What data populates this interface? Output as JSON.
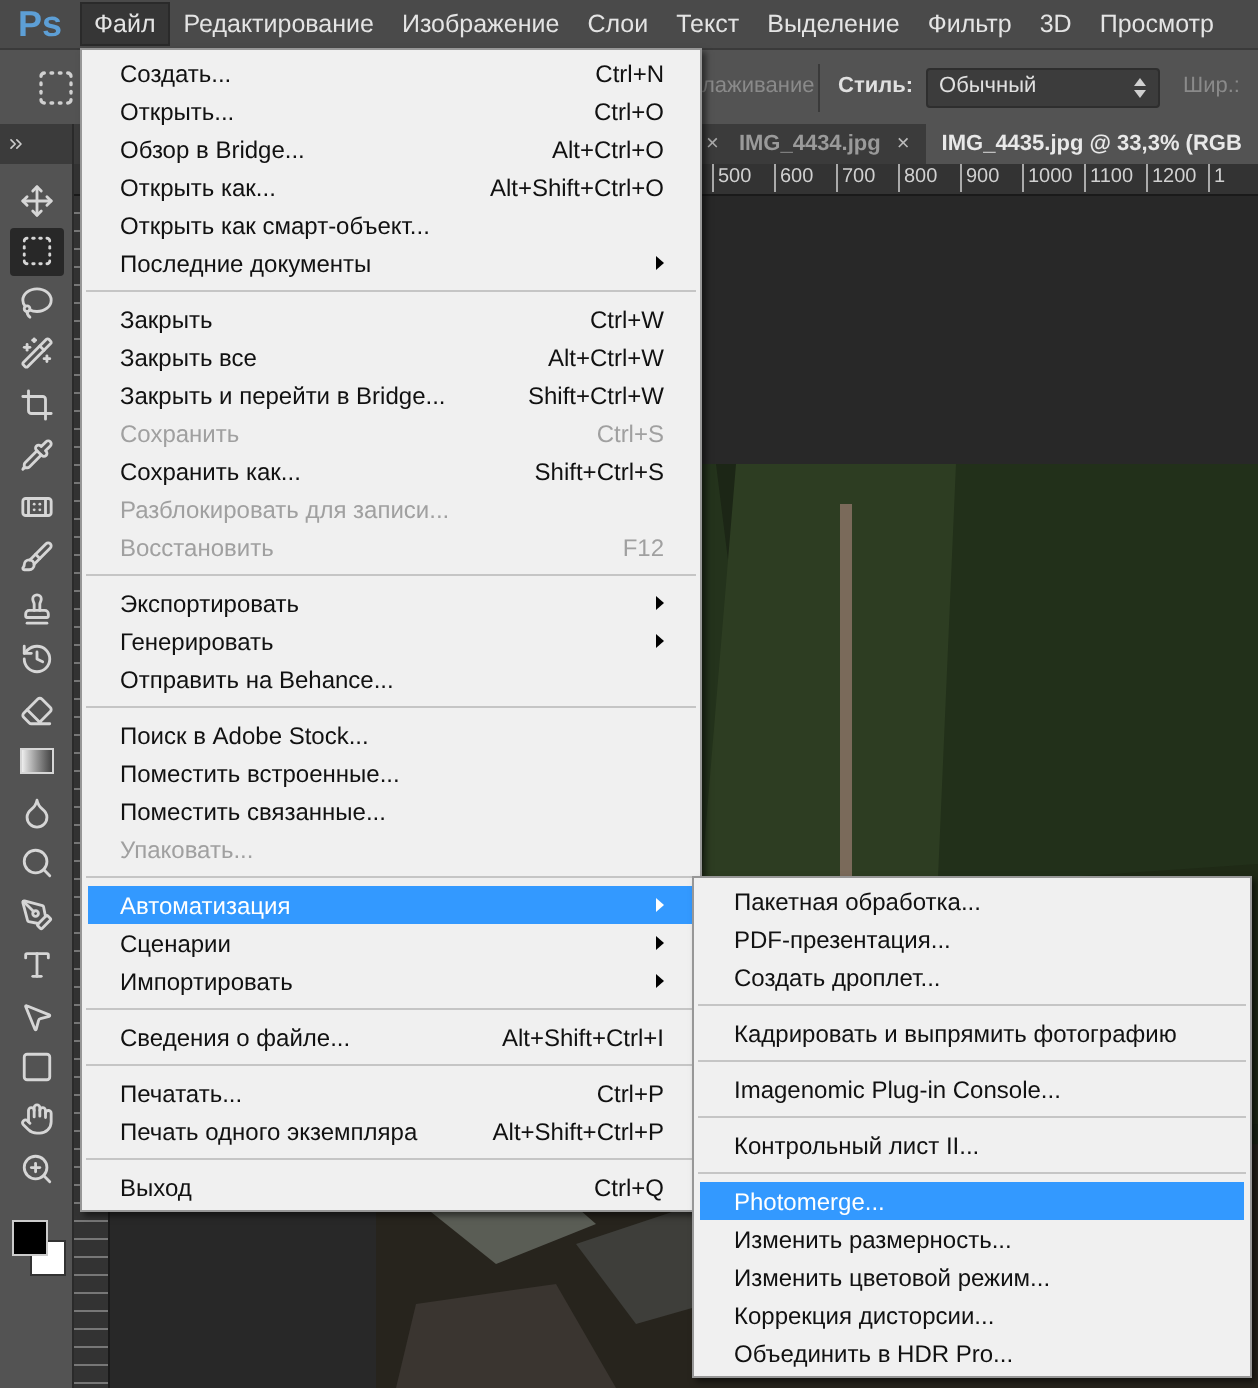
{
  "app_logo": "Ps",
  "menubar": [
    {
      "label": "Файл",
      "selected": true
    },
    {
      "label": "Редактирование",
      "selected": false
    },
    {
      "label": "Изображение",
      "selected": false
    },
    {
      "label": "Слои",
      "selected": false
    },
    {
      "label": "Текст",
      "selected": false
    },
    {
      "label": "Выделение",
      "selected": false
    },
    {
      "label": "Фильтр",
      "selected": false
    },
    {
      "label": "3D",
      "selected": false
    },
    {
      "label": "Просмотр",
      "selected": false
    }
  ],
  "options_bar": {
    "antialias_label": "лаживание",
    "style_label": "Стиль:",
    "style_value": "Обычный",
    "width_label": "Шир.:"
  },
  "document_tabs": {
    "leading_close": "×",
    "tabs": [
      {
        "label": "IMG_4434.jpg",
        "close": "×",
        "selected": false
      },
      {
        "label": "IMG_4435.jpg @ 33,3% (RGB",
        "selected": true
      }
    ]
  },
  "ruler_labels": [
    "500",
    "600",
    "700",
    "800",
    "900",
    "1000",
    "1100",
    "1200",
    "1"
  ],
  "tools": [
    {
      "kind": "move",
      "selected": false
    },
    {
      "kind": "marquee",
      "selected": true
    },
    {
      "kind": "lasso",
      "selected": false
    },
    {
      "kind": "quick",
      "selected": false
    },
    {
      "kind": "crop",
      "selected": false
    },
    {
      "kind": "eyedropper",
      "selected": false
    },
    {
      "kind": "healing",
      "selected": false
    },
    {
      "kind": "brush",
      "selected": false
    },
    {
      "kind": "stamp",
      "selected": false
    },
    {
      "kind": "history",
      "selected": false
    },
    {
      "kind": "eraser",
      "selected": false
    },
    {
      "kind": "gradient",
      "selected": false
    },
    {
      "kind": "blur",
      "selected": false
    },
    {
      "kind": "dodge",
      "selected": false
    },
    {
      "kind": "pen",
      "selected": false
    },
    {
      "kind": "type",
      "selected": false
    },
    {
      "kind": "path",
      "selected": false
    },
    {
      "kind": "shape",
      "selected": false
    },
    {
      "kind": "hand",
      "selected": false
    },
    {
      "kind": "zoom",
      "selected": false
    }
  ],
  "file_menu": [
    [
      {
        "label": "Создать...",
        "shortcut": "Ctrl+N",
        "disabled": false,
        "submenu": false,
        "selected": false
      },
      {
        "label": "Открыть...",
        "shortcut": "Ctrl+O",
        "disabled": false,
        "submenu": false,
        "selected": false
      },
      {
        "label": "Обзор в Bridge...",
        "shortcut": "Alt+Ctrl+O",
        "disabled": false,
        "submenu": false,
        "selected": false
      },
      {
        "label": "Открыть как...",
        "shortcut": "Alt+Shift+Ctrl+O",
        "disabled": false,
        "submenu": false,
        "selected": false
      },
      {
        "label": "Открыть как смарт-объект...",
        "disabled": false,
        "submenu": false,
        "selected": false
      },
      {
        "label": "Последние документы",
        "disabled": false,
        "submenu": true,
        "selected": false
      }
    ],
    [
      {
        "label": "Закрыть",
        "shortcut": "Ctrl+W",
        "disabled": false,
        "submenu": false,
        "selected": false
      },
      {
        "label": "Закрыть все",
        "shortcut": "Alt+Ctrl+W",
        "disabled": false,
        "submenu": false,
        "selected": false
      },
      {
        "label": "Закрыть и перейти в Bridge...",
        "shortcut": "Shift+Ctrl+W",
        "disabled": false,
        "submenu": false,
        "selected": false
      },
      {
        "label": "Сохранить",
        "shortcut": "Ctrl+S",
        "disabled": true,
        "submenu": false,
        "selected": false
      },
      {
        "label": "Сохранить как...",
        "shortcut": "Shift+Ctrl+S",
        "disabled": false,
        "submenu": false,
        "selected": false
      },
      {
        "label": "Разблокировать для записи...",
        "disabled": true,
        "submenu": false,
        "selected": false
      },
      {
        "label": "Восстановить",
        "shortcut": "F12",
        "disabled": true,
        "submenu": false,
        "selected": false
      }
    ],
    [
      {
        "label": "Экспортировать",
        "disabled": false,
        "submenu": true,
        "selected": false
      },
      {
        "label": "Генерировать",
        "disabled": false,
        "submenu": true,
        "selected": false
      },
      {
        "label": "Отправить на Behance...",
        "disabled": false,
        "submenu": false,
        "selected": false
      }
    ],
    [
      {
        "label": "Поиск в Adobe Stock...",
        "disabled": false,
        "submenu": false,
        "selected": false
      },
      {
        "label": "Поместить встроенные...",
        "disabled": false,
        "submenu": false,
        "selected": false
      },
      {
        "label": "Поместить связанные...",
        "disabled": false,
        "submenu": false,
        "selected": false
      },
      {
        "label": "Упаковать...",
        "disabled": true,
        "submenu": false,
        "selected": false
      }
    ],
    [
      {
        "label": "Автоматизация",
        "disabled": false,
        "submenu": true,
        "selected": true
      },
      {
        "label": "Сценарии",
        "disabled": false,
        "submenu": true,
        "selected": false
      },
      {
        "label": "Импортировать",
        "disabled": false,
        "submenu": true,
        "selected": false
      }
    ],
    [
      {
        "label": "Сведения о файле...",
        "shortcut": "Alt+Shift+Ctrl+I",
        "disabled": false,
        "submenu": false,
        "selected": false
      }
    ],
    [
      {
        "label": "Печатать...",
        "shortcut": "Ctrl+P",
        "disabled": false,
        "submenu": false,
        "selected": false
      },
      {
        "label": "Печать одного экземпляра",
        "shortcut": "Alt+Shift+Ctrl+P",
        "disabled": false,
        "submenu": false,
        "selected": false
      }
    ],
    [
      {
        "label": "Выход",
        "shortcut": "Ctrl+Q",
        "disabled": false,
        "submenu": false,
        "selected": false
      }
    ]
  ],
  "automation_submenu": [
    [
      {
        "label": "Пакетная обработка...",
        "selected": false
      },
      {
        "label": "PDF-презентация...",
        "selected": false
      },
      {
        "label": "Создать дроплет...",
        "selected": false
      }
    ],
    [
      {
        "label": "Кадрировать и выпрямить фотографию",
        "selected": false
      }
    ],
    [
      {
        "label": "Imagenomic Plug-in Console...",
        "selected": false
      }
    ],
    [
      {
        "label": "Контрольный лист II...",
        "selected": false
      }
    ],
    [
      {
        "label": "Photomerge...",
        "selected": true
      },
      {
        "label": "Изменить размерность...",
        "selected": false
      },
      {
        "label": "Изменить цветовой режим...",
        "selected": false
      },
      {
        "label": "Коррекция дисторсии...",
        "selected": false
      },
      {
        "label": "Объединить в HDR Pro...",
        "selected": false
      }
    ]
  ]
}
